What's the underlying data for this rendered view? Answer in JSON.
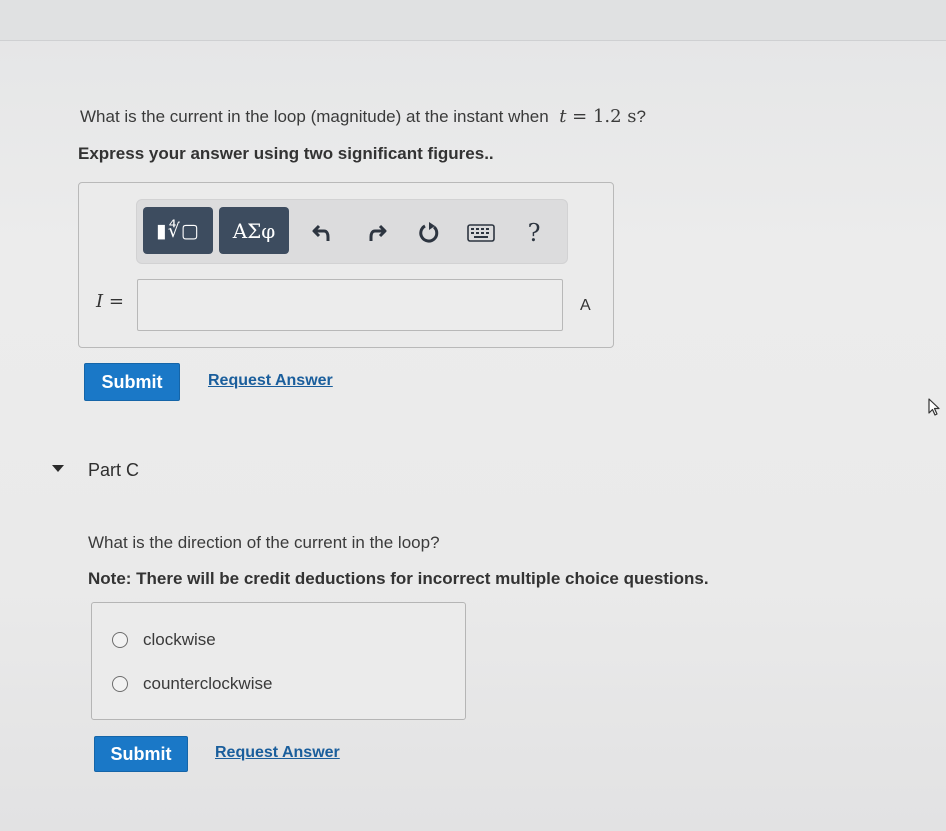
{
  "part_b": {
    "question_text": "What is the current in the loop (magnitude) at the instant when",
    "question_math": {
      "var": "t",
      "eq": " = 1.2 s"
    },
    "question_end": "?",
    "instruction": "Express your answer using two significant figures..",
    "toolbar": {
      "template_label": "▮∜▢",
      "greek_label": "ΑΣφ",
      "help_label": "?"
    },
    "variable_label": "I =",
    "input_value": "",
    "unit": "A",
    "submit_label": "Submit",
    "request_answer_label": "Request Answer"
  },
  "part_c": {
    "header": "Part C",
    "question": "What is the direction of the current in the loop?",
    "note": "Note: There will be credit deductions for incorrect multiple choice questions.",
    "options": [
      "clockwise",
      "counterclockwise"
    ],
    "submit_label": "Submit",
    "request_answer_label": "Request Answer"
  },
  "colors": {
    "primary_button": "#1a78c7",
    "toolbar_dark": "#3d4c5f",
    "link": "#1a5e9c"
  }
}
